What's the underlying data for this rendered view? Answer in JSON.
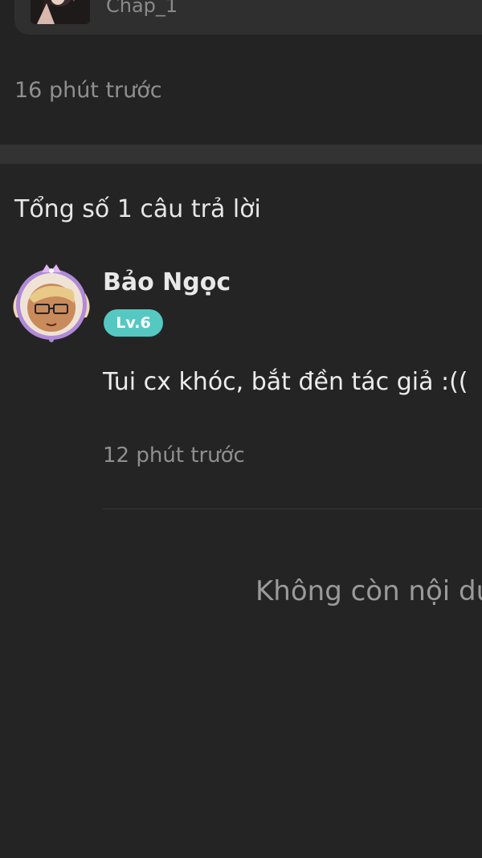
{
  "post": {
    "chapter_label": "Chap_1",
    "time": "16 phút trước"
  },
  "replies": {
    "heading": "Tổng số 1 câu trả lời",
    "items": [
      {
        "username": "Bảo Ngọc",
        "level": "Lv.6",
        "text": "Tui cx khóc, bắt đền tác giả :((",
        "time": "12 phút trước"
      }
    ]
  },
  "footer": {
    "end_message": "Không còn nội du"
  },
  "colors": {
    "background": "#242424",
    "level_badge": "#56c8c2",
    "avatar_frame": "#b18ad8"
  }
}
